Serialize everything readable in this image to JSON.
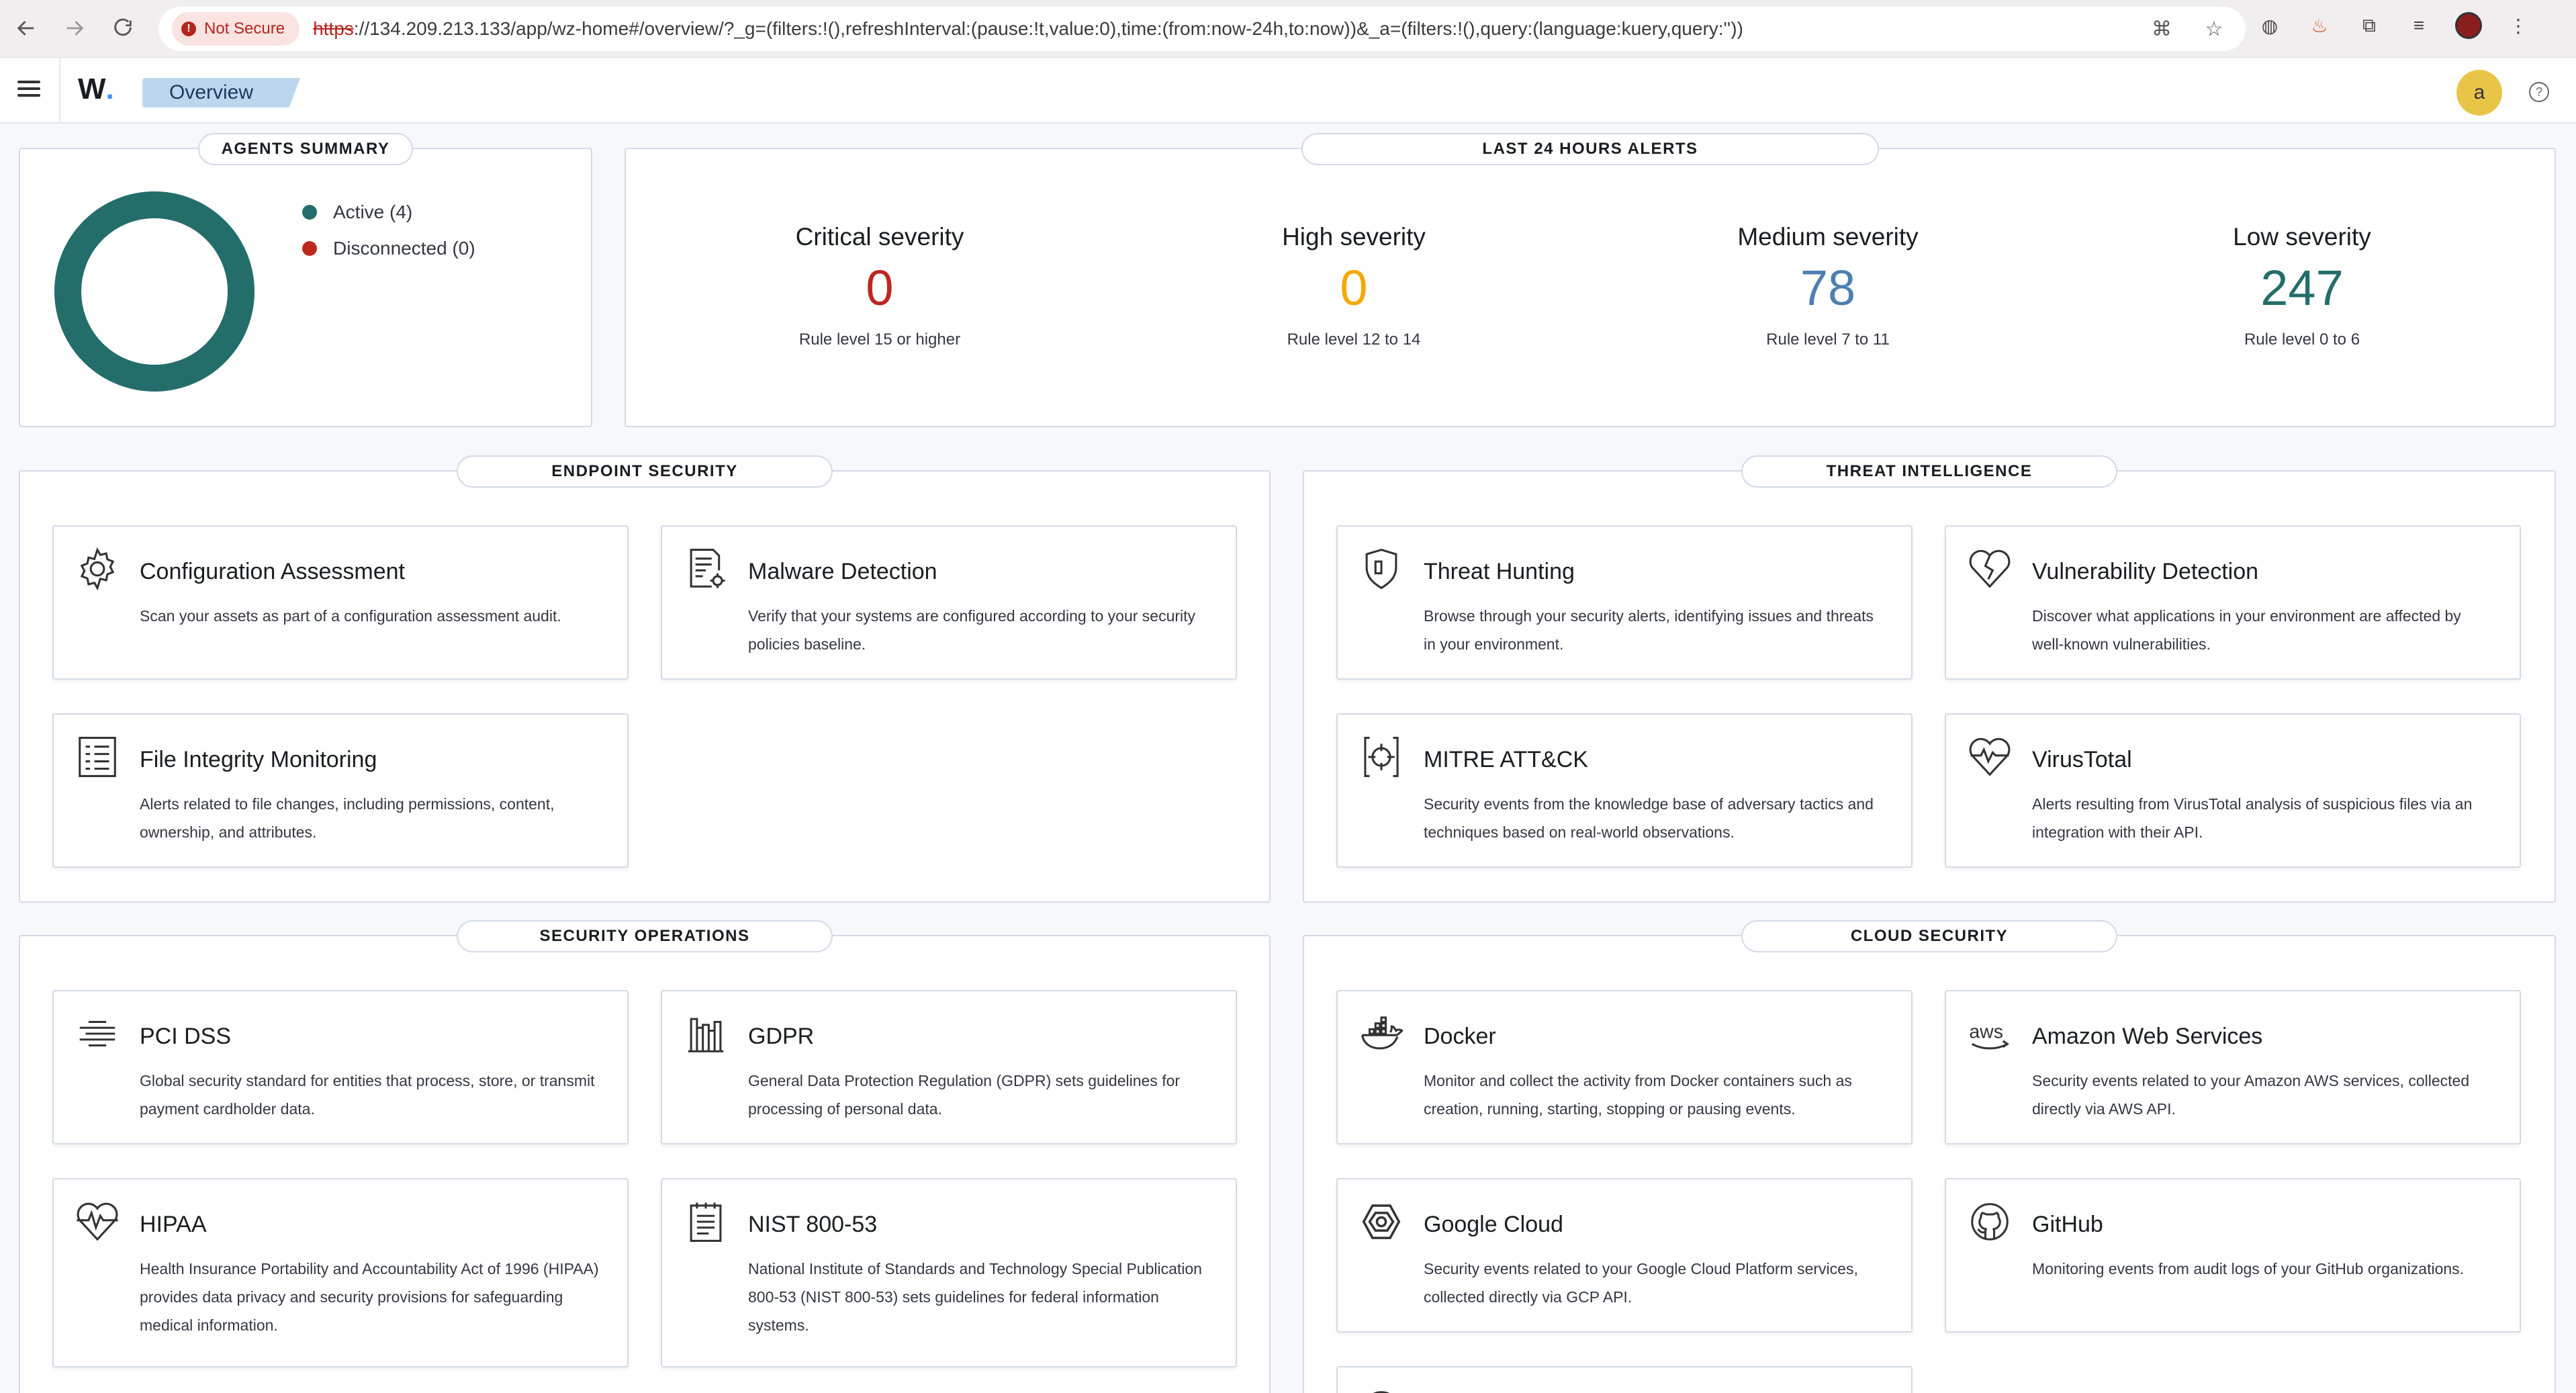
{
  "browser": {
    "security_label": "Not Secure",
    "url_scheme": "https",
    "url_rest": "://134.209.213.133/app/wz-home#/overview/?_g=(filters:!(),refreshInterval:(pause:!t,value:0),time:(from:now-24h,to:now))&_a=(filters:!(),query:(language:kuery,query:''))"
  },
  "header": {
    "logo_text": "W",
    "logo_dot": ".",
    "breadcrumb": "Overview",
    "avatar_initial": "a",
    "help": "?"
  },
  "agents_summary": {
    "title": "AGENTS SUMMARY",
    "legend": [
      {
        "label": "Active (4)",
        "color": "#236e6a"
      },
      {
        "label": "Disconnected (0)",
        "color": "#bd271e"
      }
    ]
  },
  "alerts": {
    "title": "LAST 24 HOURS ALERTS",
    "items": [
      {
        "title": "Critical severity",
        "value": "0",
        "sub": "Rule level 15 or higher",
        "color": "#bd271e"
      },
      {
        "title": "High severity",
        "value": "0",
        "sub": "Rule level 12 to 14",
        "color": "#f5a700"
      },
      {
        "title": "Medium severity",
        "value": "78",
        "sub": "Rule level 7 to 11",
        "color": "#4e7fb0"
      },
      {
        "title": "Low severity",
        "value": "247",
        "sub": "Rule level 0 to 6",
        "color": "#236e6a"
      }
    ]
  },
  "sections": {
    "endpoint": {
      "title": "ENDPOINT SECURITY",
      "cards": [
        {
          "title": "Configuration Assessment",
          "desc": "Scan your assets as part of a configuration assessment audit.",
          "icon": "gear-icon"
        },
        {
          "title": "Malware Detection",
          "desc": "Verify that your systems are configured according to your security policies baseline.",
          "icon": "document-gear-icon"
        },
        {
          "title": "File Integrity Monitoring",
          "desc": "Alerts related to file changes, including permissions, content, ownership, and attributes.",
          "icon": "list-document-icon"
        }
      ]
    },
    "threat": {
      "title": "THREAT INTELLIGENCE",
      "cards": [
        {
          "title": "Threat Hunting",
          "desc": "Browse through your security alerts, identifying issues and threats in your environment.",
          "icon": "shield-icon"
        },
        {
          "title": "Vulnerability Detection",
          "desc": "Discover what applications in your environment are affected by well-known vulnerabilities.",
          "icon": "broken-heart-icon"
        },
        {
          "title": "MITRE ATT&CK",
          "desc": "Security events from the knowledge base of adversary tactics and techniques based on real-world observations.",
          "icon": "crosshair-icon"
        },
        {
          "title": "VirusTotal",
          "desc": "Alerts resulting from VirusTotal analysis of suspicious files via an integration with their API.",
          "icon": "heart-pulse-icon"
        }
      ]
    },
    "secops": {
      "title": "SECURITY OPERATIONS",
      "cards": [
        {
          "title": "PCI DSS",
          "desc": "Global security standard for entities that process, store, or transmit payment cardholder data.",
          "icon": "lines-icon"
        },
        {
          "title": "GDPR",
          "desc": "General Data Protection Regulation (GDPR) sets guidelines for processing of personal data.",
          "icon": "building-icon"
        },
        {
          "title": "HIPAA",
          "desc": "Health Insurance Portability and Accountability Act of 1996 (HIPAA) provides data privacy and security provisions for safeguarding medical information.",
          "icon": "heartbeat-icon"
        },
        {
          "title": "NIST 800-53",
          "desc": "National Institute of Standards and Technology Special Publication 800-53 (NIST 800-53) sets guidelines for federal information systems.",
          "icon": "notepad-icon"
        }
      ]
    },
    "cloud": {
      "title": "CLOUD SECURITY",
      "cards": [
        {
          "title": "Docker",
          "desc": "Monitor and collect the activity from Docker containers such as creation, running, starting, stopping or pausing events.",
          "icon": "docker-icon"
        },
        {
          "title": "Amazon Web Services",
          "desc": "Security events related to your Amazon AWS services, collected directly via AWS API.",
          "icon": "aws-icon"
        },
        {
          "title": "Google Cloud",
          "desc": "Security events related to your Google Cloud Platform services, collected directly via GCP API.",
          "icon": "google-cloud-icon"
        },
        {
          "title": "GitHub",
          "desc": "Monitoring events from audit logs of your GitHub organizations.",
          "icon": "github-icon"
        }
      ]
    }
  }
}
